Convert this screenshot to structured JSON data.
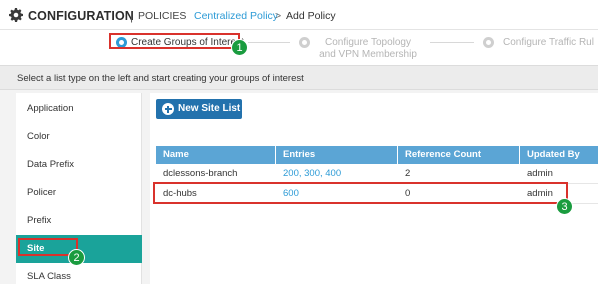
{
  "header": {
    "title": "CONFIGURATION",
    "separator": "|",
    "section": "POLICIES",
    "breadcrumb_link": "Centralized Policy",
    "breadcrumb_arrow": ">",
    "breadcrumb_current": "Add Policy",
    "icon": "gear-icon"
  },
  "steps": [
    {
      "label": "Create Groups of Interest",
      "state": "active"
    },
    {
      "label": "Configure Topology and VPN Membership",
      "state": "inactive"
    },
    {
      "label": "Configure Traffic Rul",
      "state": "inactive"
    }
  ],
  "instruction": "Select a list type on the left and start creating your groups of interest",
  "sidebar": {
    "items": [
      {
        "label": "Application"
      },
      {
        "label": "Color"
      },
      {
        "label": "Data Prefix"
      },
      {
        "label": "Policer"
      },
      {
        "label": "Prefix"
      },
      {
        "label": "Site"
      },
      {
        "label": "SLA Class"
      }
    ],
    "selected": "Site"
  },
  "toolbar": {
    "new_button_label": "New Site List"
  },
  "table": {
    "columns": [
      "Name",
      "Entries",
      "Reference Count",
      "Updated By"
    ],
    "rows": [
      {
        "name": "dclessons-branch",
        "entries": "200, 300, 400",
        "reference_count": "2",
        "updated_by": "admin"
      },
      {
        "name": "dc-hubs",
        "entries": "600",
        "reference_count": "0",
        "updated_by": "admin"
      }
    ]
  },
  "annotations": {
    "badge1": "1",
    "badge2": "2",
    "badge3": "3"
  },
  "colors": {
    "accent": "#2d9bd6",
    "active_sidebar": "#1aa39a",
    "table_header": "#5ba5d5",
    "button": "#2372ad",
    "highlight": "#d9322c",
    "badge": "#1a9c3f"
  }
}
